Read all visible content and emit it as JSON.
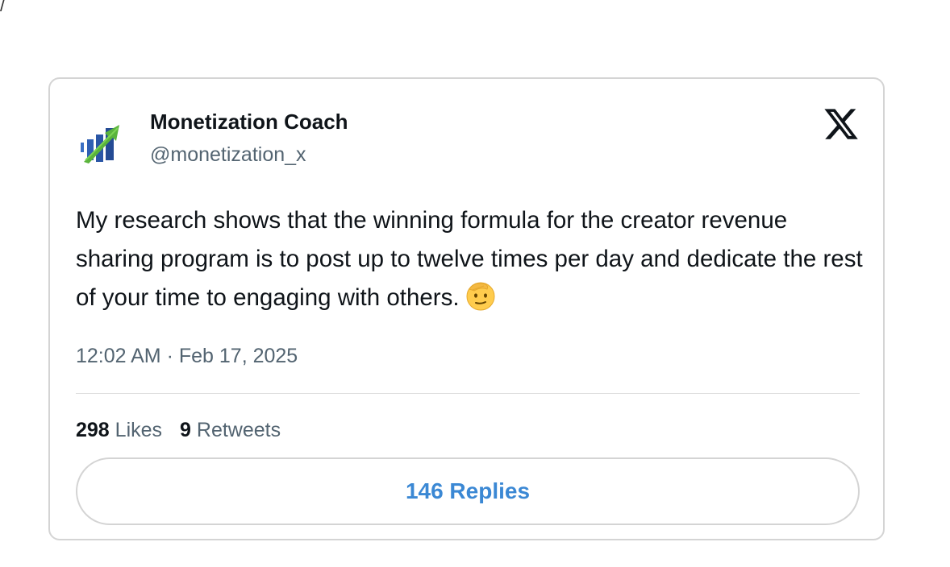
{
  "page": {
    "corner_fragment": "/"
  },
  "tweet": {
    "author_name": "Monetization Coach",
    "author_handle": "@monetization_x",
    "avatar_icon": "bar-chart-growth-icon",
    "platform_icon": "x-logo-icon",
    "text": "My research shows that the winning formula for the creator revenue sharing program is to post up to twelve times per day and dedicate the rest of your time to engaging with others.",
    "emoji": "saluting-face-emoji",
    "time": "12:02 AM",
    "separator": "·",
    "date": "Feb 17, 2025",
    "likes_count": "298",
    "likes_label": "Likes",
    "retweets_count": "9",
    "retweets_label": "Retweets",
    "replies_button_label": "146 Replies"
  },
  "colors": {
    "text_primary": "#0f1419",
    "text_secondary": "#536471",
    "link_blue": "#3b88d4",
    "border": "#d4d4d4"
  }
}
